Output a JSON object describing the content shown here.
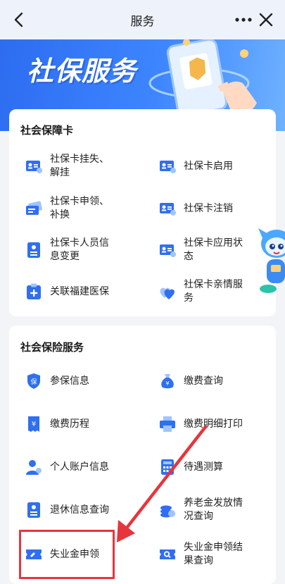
{
  "header": {
    "title": "服务",
    "icons": [
      "back-chevron-icon",
      "more-dots-icon",
      "close-icon"
    ]
  },
  "banner": {
    "title": "社保服务",
    "illustration": "phone-with-card-and-hand"
  },
  "cards": {
    "social_security_card": {
      "title": "社会保障卡",
      "items": [
        {
          "label_line1": "社保卡挂失、",
          "label_line2": "解挂",
          "icon": "id-card-icon"
        },
        {
          "label_line1": "社保卡启用",
          "label_line2": "",
          "icon": "id-card-icon"
        },
        {
          "label_line1": "社保卡申领、",
          "label_line2": "补换",
          "icon": "card-swap-icon"
        },
        {
          "label_line1": "社保卡注销",
          "label_line2": "",
          "icon": "id-card-icon"
        },
        {
          "label_line1": "社保卡人员信",
          "label_line2": "息变更",
          "icon": "profile-document-icon"
        },
        {
          "label_line1": "社保卡应用状",
          "label_line2": "态",
          "icon": "id-card-icon"
        },
        {
          "label_line1": "关联福建医保",
          "label_line2": "",
          "icon": "medical-plus-icon"
        },
        {
          "label_line1": "社保卡亲情服",
          "label_line2": "务",
          "icon": "hearts-icon"
        }
      ]
    },
    "insurance_services": {
      "title": "社会保险服务",
      "items": [
        {
          "label_line1": "参保信息",
          "label_line2": "",
          "icon": "shield-icon"
        },
        {
          "label_line1": "缴费查询",
          "label_line2": "",
          "icon": "money-bag-icon"
        },
        {
          "label_line1": "缴费历程",
          "label_line2": "",
          "icon": "receipt-yuan-icon"
        },
        {
          "label_line1": "缴费明细打印",
          "label_line2": "",
          "icon": "printer-icon"
        },
        {
          "label_line1": "个人账户信息",
          "label_line2": "",
          "icon": "user-account-icon"
        },
        {
          "label_line1": "待遇测算",
          "label_line2": "",
          "icon": "calculator-icon"
        },
        {
          "label_line1": "退休信息查询",
          "label_line2": "",
          "icon": "profile-document-icon"
        },
        {
          "label_line1": "养老金发放情",
          "label_line2": "况查询",
          "icon": "coin-stack-icon"
        },
        {
          "label_line1": "失业金申领",
          "label_line2": "",
          "icon": "ticket-icon"
        },
        {
          "label_line1": "失业金申领结",
          "label_line2": "果查询",
          "icon": "ticket-search-icon"
        }
      ]
    }
  },
  "annotations": {
    "highlight_color": "#e8343c",
    "highlight_target": "失业金申领"
  },
  "colors": {
    "accent": "#2f6ff0",
    "banner_start": "#2d6cf0",
    "banner_end": "#6fb2ff",
    "icon_blue": "#2f6ff0",
    "icon_light": "#9fc4ff"
  }
}
